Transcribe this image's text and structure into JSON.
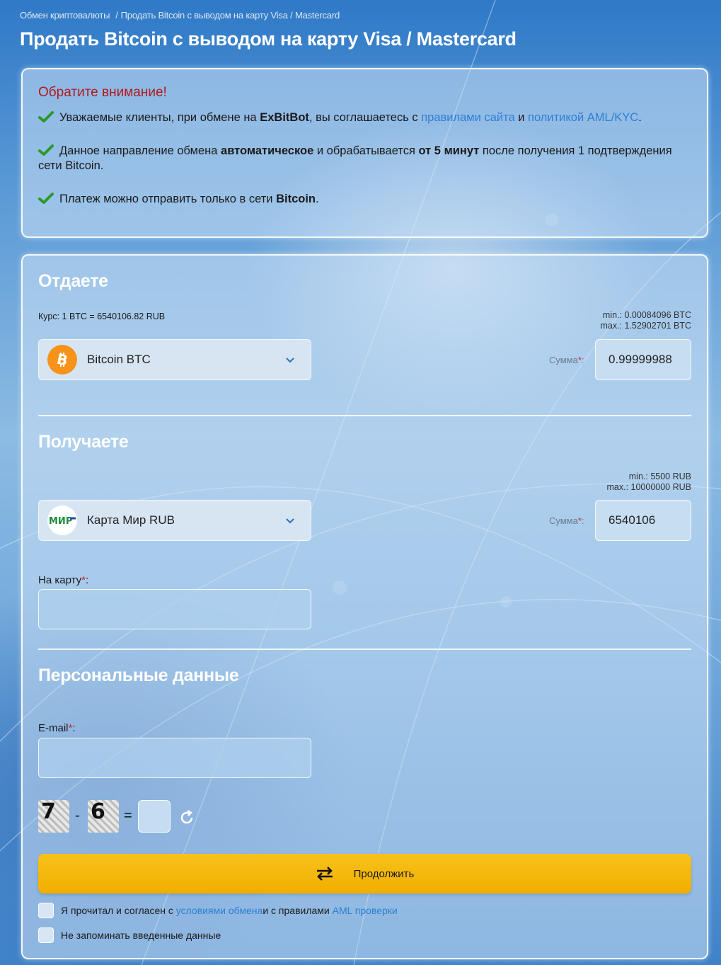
{
  "breadcrumb": {
    "home": "Обмен криптовалюты",
    "separator": "/",
    "current": "Продать Bitcoin с выводом на карту Visa / Mastercard"
  },
  "page_title": "Продать Bitcoin с выводом на карту Visa / Mastercard",
  "notice": {
    "title": "Обратите внимание!",
    "item1": {
      "p1": "Уважаемые клиенты, при обмене на ",
      "brand": "ExBitBot",
      "p2": ", вы соглашаетесь с ",
      "link_rules": "правилами сайта",
      "p3": " и ",
      "link_policy": "политикой AML/KYC",
      "p4": "."
    },
    "item2": {
      "p1": "Данное направление обмена ",
      "bold1": "автоматическое",
      "p2": " и обрабатывается ",
      "bold2": "от 5 минут",
      "p3": " после получения 1 подтверждения сети Bitcoin."
    },
    "item3": {
      "p1": "Платеж можно отправить только в сети ",
      "bold": "Bitcoin",
      "p2": "."
    }
  },
  "give": {
    "title": "Отдаете",
    "rate": "Курс: 1 BTC = 6540106.82 RUB",
    "min": "min.: 0.00084096 BTC",
    "max": "max.: 1.52902701 BTC",
    "currency": "Bitcoin BTC",
    "currency_icon": "bitcoin-icon",
    "sum_label": "Сумма",
    "required_mark": "*",
    "colon": ":",
    "sum_value": "0.99999988"
  },
  "get": {
    "title": "Получаете",
    "min": "min.: 5500 RUB",
    "max": "max.: 10000000 RUB",
    "currency": "Карта Мир RUB",
    "currency_icon": "mir-icon",
    "mir_logo_text": "МИР",
    "sum_label": "Сумма",
    "required_mark": "*",
    "colon": ":",
    "sum_value": "6540106",
    "card_label": "На карту",
    "card_required": "*",
    "card_colon": ":"
  },
  "personal": {
    "title": "Персональные данные",
    "email_label": "E-mail",
    "email_required": "*",
    "email_colon": ":"
  },
  "captcha": {
    "a": "7",
    "op": "-",
    "b": "6",
    "eq": "="
  },
  "submit": {
    "label": "Продолжить"
  },
  "agree": {
    "p1": "Я прочитал и согласен с ",
    "link1": "условиями обмена",
    "p2": " и с правилами ",
    "link2": "AML проверки"
  },
  "no_remember": "Не запоминать введенные данные",
  "colors": {
    "accent_link": "#2e7fd2",
    "warning_title": "#b3191e",
    "button": "#f5b800",
    "bitcoin": "#f7931a",
    "mir_green": "#1c8a3e",
    "mir_blue": "#1a4fa0"
  }
}
